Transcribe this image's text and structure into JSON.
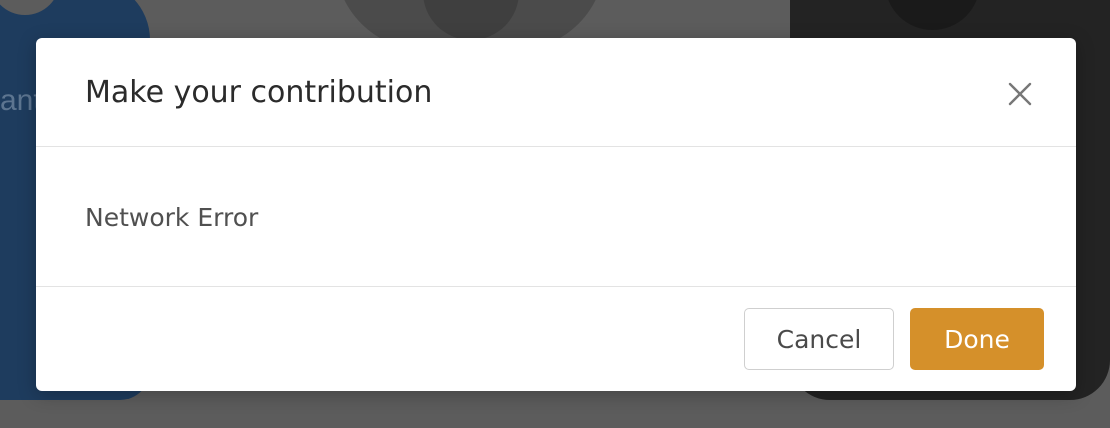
{
  "background": {
    "partial_text": "ant"
  },
  "modal": {
    "title": "Make your contribution",
    "close_icon": "close-icon",
    "body_message": "Network Error",
    "cancel_label": "Cancel",
    "done_label": "Done"
  },
  "colors": {
    "accent": "#d5902a",
    "overlay": "#5c5c5c"
  }
}
